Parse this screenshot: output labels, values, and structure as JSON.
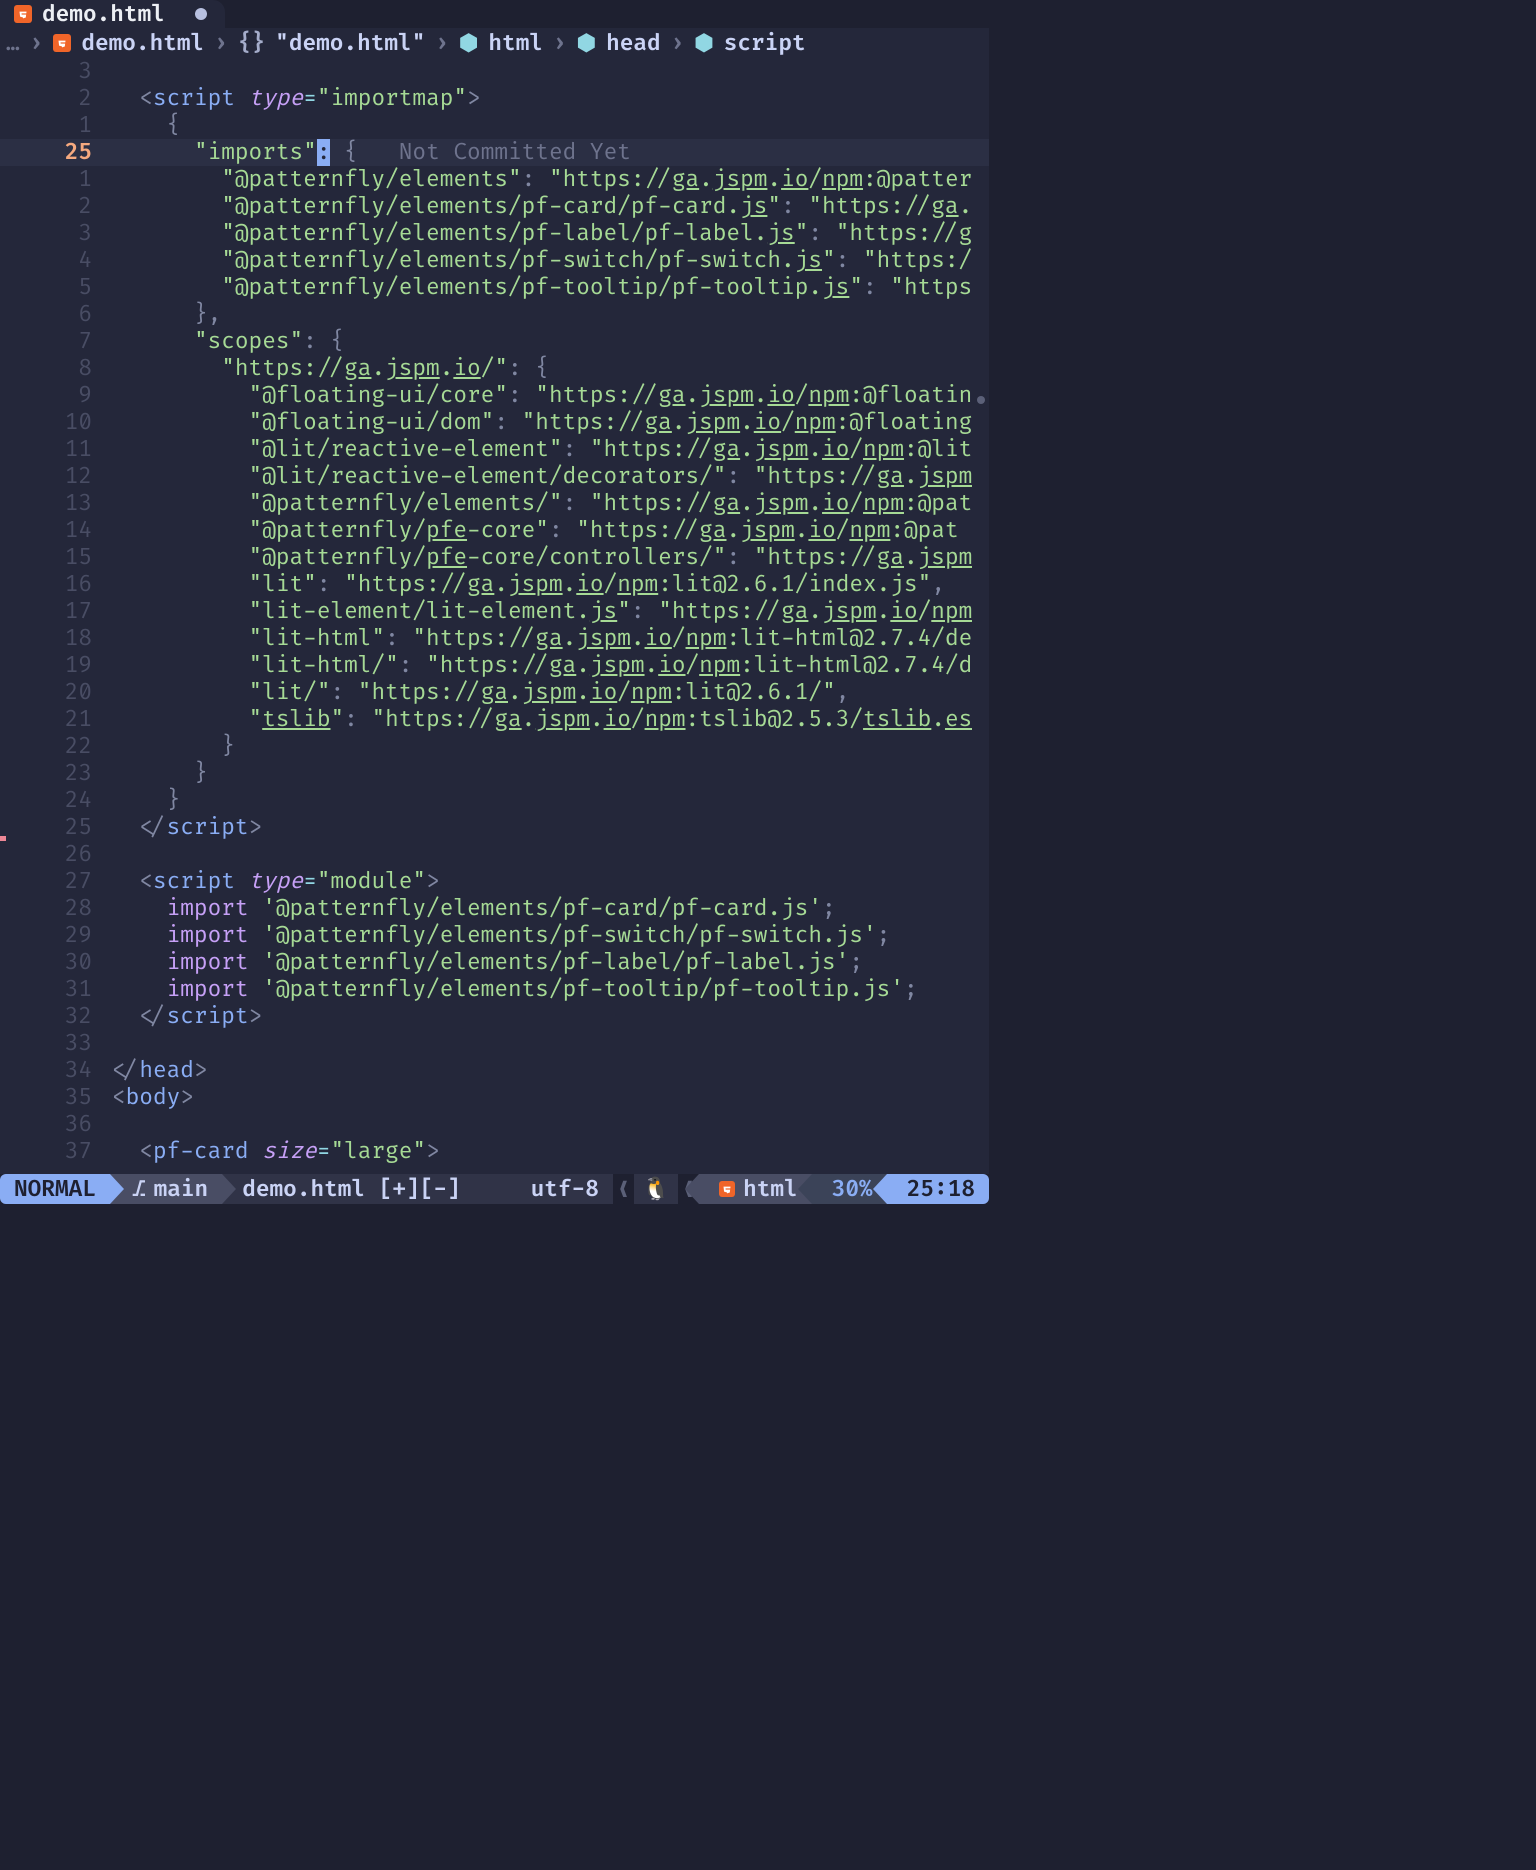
{
  "tab": {
    "name": "demo.html",
    "dirty": true
  },
  "breadcrumb": {
    "ellipsis": "…",
    "file": "demo.html",
    "sym1": "\"demo.html\"",
    "sym2": "html",
    "sym3": "head",
    "sym4": "script"
  },
  "blame": "Not Committed Yet",
  "gutter_rel": [
    "3",
    "2",
    "1",
    "25",
    "1",
    "2",
    "3",
    "4",
    "5",
    "6",
    "7",
    "8",
    "9",
    "10",
    "11",
    "12",
    "13",
    "14",
    "15",
    "16",
    "17",
    "18",
    "19",
    "20",
    "21",
    "22",
    "23",
    "24",
    "25",
    "26",
    "27",
    "28",
    "29",
    "30",
    "31",
    "32",
    "33",
    "34",
    "35",
    "36",
    "37"
  ],
  "code": {
    "l22": {
      "open": "<",
      "tag": "script",
      "attr": "type",
      "eq": "=",
      "val": "\"importmap\"",
      "close": ">"
    },
    "l23": "{",
    "l24": {
      "key": "\"imports\"",
      "colon": ":",
      "brace": "{"
    },
    "l25": {
      "k": "\"@patternfly/elements\"",
      "colon": ": ",
      "v": "\"https://",
      "u1": "ga",
      "d1": ".",
      "u2": "jspm",
      "d2": ".",
      "u3": "io",
      "s": "/",
      "u4": "npm",
      "rest": ":@patter"
    },
    "l26": {
      "k": "\"@patternfly/elements/pf-card/pf-card.",
      "ku": "js",
      "k2": "\"",
      "colon": ": ",
      "v": "\"https://",
      "u1": "ga",
      "rest": "."
    },
    "l27": {
      "k": "\"@patternfly/elements/pf-label/pf-label.",
      "ku": "js",
      "k2": "\"",
      "colon": ": ",
      "v": "\"https://",
      "u1": "g"
    },
    "l28": {
      "k": "\"@patternfly/elements/pf-switch/pf-switch.",
      "ku": "js",
      "k2": "\"",
      "colon": ": ",
      "v": "\"https:/"
    },
    "l29": {
      "k": "\"@patternfly/elements/pf-tooltip/pf-tooltip.",
      "ku": "js",
      "k2": "\"",
      "colon": ": ",
      "v": "\"https"
    },
    "l30": "},",
    "l31": {
      "k": "\"scopes\"",
      "colon": ": ",
      "brace": "{"
    },
    "l32": {
      "k": "\"https://",
      "u1": "ga",
      "d1": ".",
      "u2": "jspm",
      "d2": ".",
      "u3": "io",
      "s": "/\"",
      "colon": ": ",
      "brace": "{"
    },
    "l33": {
      "k": "\"@floating-ui/core\"",
      "colon": ": ",
      "v": "\"https://",
      "u1": "ga",
      "d1": ".",
      "u2": "jspm",
      "d2": ".",
      "u3": "io",
      "s": "/",
      "u4": "npm",
      "rest": ":@floatin"
    },
    "l34": {
      "k": "\"@floating-ui/dom\"",
      "colon": ": ",
      "v": "\"https://",
      "u1": "ga",
      "d1": ".",
      "u2": "jspm",
      "d2": ".",
      "u3": "io",
      "s": "/",
      "u4": "npm",
      "rest": ":@floating"
    },
    "l35": {
      "k": "\"@lit/reactive-element\"",
      "colon": ": ",
      "v": "\"https://",
      "u1": "ga",
      "d1": ".",
      "u2": "jspm",
      "d2": ".",
      "u3": "io",
      "s": "/",
      "u4": "npm",
      "rest": ":@lit"
    },
    "l36": {
      "k": "\"@lit/reactive-element/decorators/\"",
      "colon": ": ",
      "v": "\"https://",
      "u1": "ga",
      "d1": ".",
      "u2": "jspm"
    },
    "l37": {
      "k": "\"@patternfly/elements/\"",
      "colon": ": ",
      "v": "\"https://",
      "u1": "ga",
      "d1": ".",
      "u2": "jspm",
      "d2": ".",
      "u3": "io",
      "s": "/",
      "u4": "npm",
      "rest": ":@pat"
    },
    "l38": {
      "k": "\"@patternfly/",
      "ku": "pfe",
      "k2": "-core\"",
      "colon": ": ",
      "v": "\"https://",
      "u1": "ga",
      "d1": ".",
      "u2": "jspm",
      "d2": ".",
      "u3": "io",
      "s": "/",
      "u4": "npm",
      "rest": ":@pat"
    },
    "l39": {
      "k": "\"@patternfly/",
      "ku": "pfe",
      "k2": "-core/controllers/\"",
      "colon": ": ",
      "v": "\"https://",
      "u1": "ga",
      "d1": ".",
      "u2": "jspm"
    },
    "l40": {
      "k": "\"lit\"",
      "colon": ": ",
      "v": "\"https://",
      "u1": "ga",
      "d1": ".",
      "u2": "jspm",
      "d2": ".",
      "u3": "io",
      "s": "/",
      "u4": "npm",
      "rest": ":lit@2.6.1/index.js\"",
      "comma": ","
    },
    "l41": {
      "k": "\"lit-element/lit-element.",
      "ku": "js",
      "k2": "\"",
      "colon": ": ",
      "v": "\"https://",
      "u1": "ga",
      "d1": ".",
      "u2": "jspm",
      "d2": ".",
      "u3": "io",
      "s": "/",
      "u4": "npm"
    },
    "l42": {
      "k": "\"lit-html\"",
      "colon": ": ",
      "v": "\"https://",
      "u1": "ga",
      "d1": ".",
      "u2": "jspm",
      "d2": ".",
      "u3": "io",
      "s": "/",
      "u4": "npm",
      "rest": ":lit-html@2.7.4/de"
    },
    "l43": {
      "k": "\"lit-html/\"",
      "colon": ": ",
      "v": "\"https://",
      "u1": "ga",
      "d1": ".",
      "u2": "jspm",
      "d2": ".",
      "u3": "io",
      "s": "/",
      "u4": "npm",
      "rest": ":lit-html@2.7.4/d"
    },
    "l44": {
      "k": "\"lit/\"",
      "colon": ": ",
      "v": "\"https://",
      "u1": "ga",
      "d1": ".",
      "u2": "jspm",
      "d2": ".",
      "u3": "io",
      "s": "/",
      "u4": "npm",
      "rest": ":lit@2.6.1/\"",
      "comma": ","
    },
    "l45": {
      "k": "\"",
      "ku": "tslib",
      "k2": "\"",
      "colon": ": ",
      "v": "\"https://",
      "u1": "ga",
      "d1": ".",
      "u2": "jspm",
      "d2": ".",
      "u3": "io",
      "s": "/",
      "u4": "npm",
      "rest": ":tslib@2.5.3/",
      "u5": "tslib",
      "d3": ".",
      "u6": "es"
    },
    "l46": "}",
    "l47": "}",
    "l48": "}",
    "l49": {
      "open": "</",
      "tag": "script",
      "close": ">"
    },
    "l51": {
      "open": "<",
      "tag": "script",
      "attr": "type",
      "eq": "=",
      "val": "\"module\"",
      "close": ">"
    },
    "l52": {
      "kw": "import",
      "s": "'@patternfly/elements/pf-card/pf-card.js'",
      "semi": ";"
    },
    "l53": {
      "kw": "import",
      "s": "'@patternfly/elements/pf-switch/pf-switch.js'",
      "semi": ";"
    },
    "l54": {
      "kw": "import",
      "s": "'@patternfly/elements/pf-label/pf-label.js'",
      "semi": ";"
    },
    "l55": {
      "kw": "import",
      "s": "'@patternfly/elements/pf-tooltip/pf-tooltip.js'",
      "semi": ";"
    },
    "l56": {
      "open": "</",
      "tag": "script",
      "close": ">"
    },
    "l58": {
      "open": "</",
      "tag": "head",
      "close": ">"
    },
    "l59": {
      "open": "<",
      "tag": "body",
      "close": ">"
    },
    "l61": {
      "open": "<",
      "tag": "pf-card",
      "attr": "size",
      "eq": "=",
      "val": "\"large\"",
      "close": ">"
    }
  },
  "status": {
    "mode": "NORMAL",
    "branch": "main",
    "file": "demo.html [+][-]",
    "encoding": "utf-8",
    "filetype": "html",
    "percent": "30%",
    "position": "25:18"
  }
}
